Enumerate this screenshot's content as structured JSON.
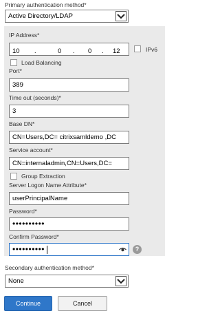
{
  "primary_auth": {
    "label": "Primary authentication method*",
    "selected": "Active Directory/LDAP"
  },
  "ip_address": {
    "label": "IP Address*",
    "octets": [
      "10",
      "0",
      "0",
      "12"
    ],
    "ipv6_label": "IPv6"
  },
  "load_balancing_label": "Load Balancing",
  "port": {
    "label": "Port*",
    "value": "389"
  },
  "timeout": {
    "label": "Time out (seconds)*",
    "value": "3"
  },
  "base_dn": {
    "label": "Base DN*",
    "value": "CN=Users,DC= citrixsamldemo ,DC"
  },
  "service_account": {
    "label": "Service account*",
    "value": "CN=internaladmin,CN=Users,DC="
  },
  "group_extraction_label": "Group Extraction",
  "server_logon_attr": {
    "label": "Server Logon Name Attribute*",
    "value": "userPrincipalName"
  },
  "password": {
    "label": "Password*",
    "value": "••••••••••"
  },
  "confirm_password": {
    "label": "Confirm Password*",
    "value": "••••••••••"
  },
  "secondary_auth": {
    "label": "Secondary authentication method*",
    "selected": "None"
  },
  "buttons": {
    "continue": "Continue",
    "cancel": "Cancel"
  },
  "help_glyph": "?",
  "colors": {
    "accent": "#2f77c9",
    "focus_border": "#2f77c9",
    "panel_bg": "#eaeaea"
  },
  "icons": [
    "chevron-down-icon",
    "eye-icon",
    "help-icon"
  ]
}
